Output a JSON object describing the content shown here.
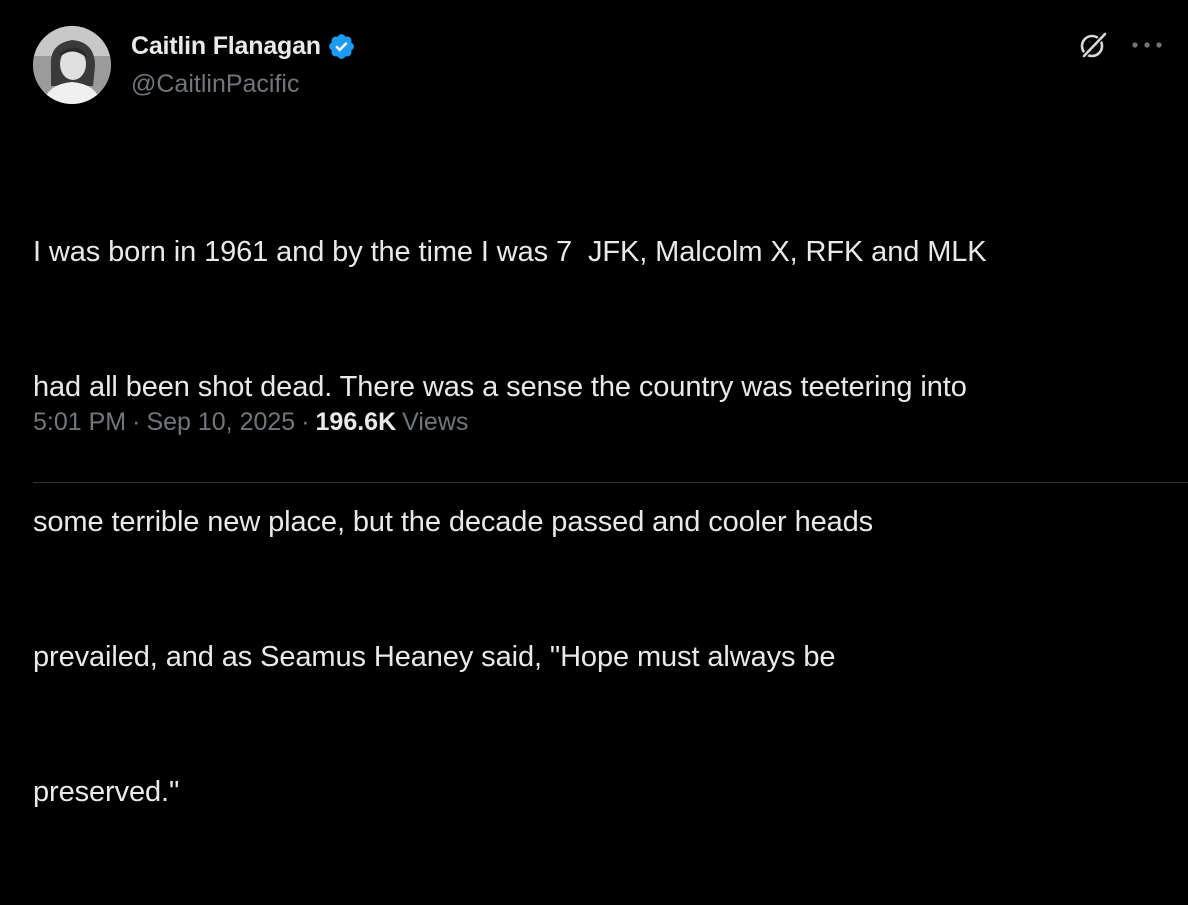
{
  "author": {
    "name": "Caitlin Flanagan",
    "handle": "@CaitlinPacific",
    "verified_color": "#1d9bf0"
  },
  "tweet": {
    "lines": [
      "I was born in 1961 and by the time I was 7  JFK, Malcolm X, RFK and MLK",
      "had all been shot dead. There was a sense the country was teetering into",
      "some terrible new place, but the decade passed and cooler heads",
      "prevailed, and as Seamus Heaney said, \"Hope must always be",
      "preserved.\""
    ]
  },
  "meta": {
    "time": "5:01 PM",
    "separator": "·",
    "date": "Sep 10, 2025",
    "views_count": "196.6K",
    "views_label": "Views"
  },
  "icons": {
    "grok": "grok-icon",
    "more": "more-icon",
    "verified": "verified-badge-icon"
  },
  "colors": {
    "background": "#000000",
    "text_primary": "#e7e9ea",
    "text_secondary": "#71767b",
    "accent": "#1d9bf0"
  }
}
